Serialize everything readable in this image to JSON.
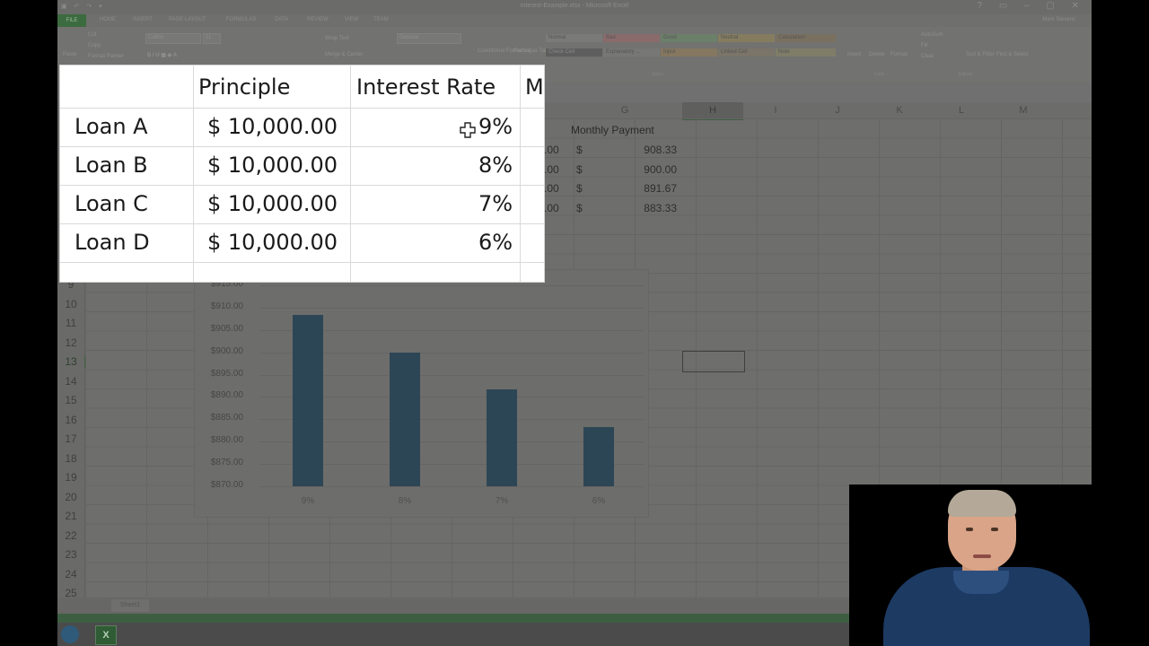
{
  "excel": {
    "title": "Interest-Example.xlsx - Microsoft Excel",
    "user": "Mark Stevens",
    "tabs": [
      "FILE",
      "HOME",
      "INSERT",
      "PAGE LAYOUT",
      "FORMULAS",
      "DATA",
      "REVIEW",
      "VIEW",
      "TEAM"
    ],
    "clipboard": {
      "paste": "Paste",
      "cut": "Cut",
      "copy": "Copy",
      "format_painter": "Format Painter"
    },
    "font": {
      "name": "Calibri",
      "size": "11"
    },
    "alignment": {
      "wrap_text": "Wrap Text",
      "merge": "Merge & Center"
    },
    "number": {
      "format": "General"
    },
    "styles": {
      "conditional": "Conditional Formatting",
      "format_as_table": "Format as Table",
      "normal": "Normal",
      "bad": "Bad",
      "good": "Good",
      "neutral": "Neutral",
      "calculation": "Calculation",
      "check_cell": "Check Cell",
      "explanatory": "Explanatory ...",
      "input": "Input",
      "linked_cell": "Linked Cell",
      "note": "Note"
    },
    "cells": {
      "insert": "Insert",
      "delete": "Delete",
      "format": "Format"
    },
    "editing": {
      "autosum": "AutoSum",
      "fill": "Fill",
      "clear": "Clear",
      "sort": "Sort & Filter",
      "find": "Find & Select"
    },
    "group_labels": {
      "styles": "Styles",
      "cells": "Cells",
      "editing": "Editing"
    },
    "columns": [
      "G",
      "H",
      "I",
      "J",
      "K",
      "L",
      "M"
    ],
    "selected_column": "H",
    "rows": [
      "9",
      "10",
      "11",
      "12",
      "13",
      "14",
      "15",
      "16",
      "17",
      "18",
      "19",
      "20",
      "21",
      "22",
      "23",
      "24",
      "25"
    ],
    "selected_row": "13",
    "monthly_payment_header": "Monthly Payment",
    "payment_rows": [
      {
        "partial": ".00",
        "currency": "$",
        "value": "908.33"
      },
      {
        "partial": ".00",
        "currency": "$",
        "value": "900.00"
      },
      {
        "partial": ".00",
        "currency": "$",
        "value": "891.67"
      },
      {
        "partial": ".00",
        "currency": "$",
        "value": "883.33"
      }
    ],
    "sheet_tab": "Sheet1"
  },
  "zoom_table": {
    "headers": [
      "Principle",
      "Interest Rate",
      "M"
    ],
    "rows": [
      {
        "loan": "Loan A",
        "principle": "$ 10,000.00",
        "rate": "9%"
      },
      {
        "loan": "Loan B",
        "principle": "$ 10,000.00",
        "rate": "8%"
      },
      {
        "loan": "Loan C",
        "principle": "$ 10,000.00",
        "rate": "7%"
      },
      {
        "loan": "Loan D",
        "principle": "$ 10,000.00",
        "rate": "6%"
      }
    ]
  },
  "chart_data": {
    "type": "bar",
    "categories": [
      "9%",
      "8%",
      "7%",
      "6%"
    ],
    "values": [
      908.33,
      900.0,
      891.67,
      883.33
    ],
    "ylim": [
      870,
      915
    ],
    "ytick_labels": [
      "$915.00",
      "$910.00",
      "$905.00",
      "$900.00",
      "$895.00",
      "$890.00",
      "$885.00",
      "$880.00",
      "$875.00",
      "$870.00"
    ],
    "title": "",
    "xlabel": "",
    "ylabel": "",
    "grid": true,
    "bar_color": "#2d4655"
  },
  "taskbar": {
    "excel_icon": "X"
  }
}
